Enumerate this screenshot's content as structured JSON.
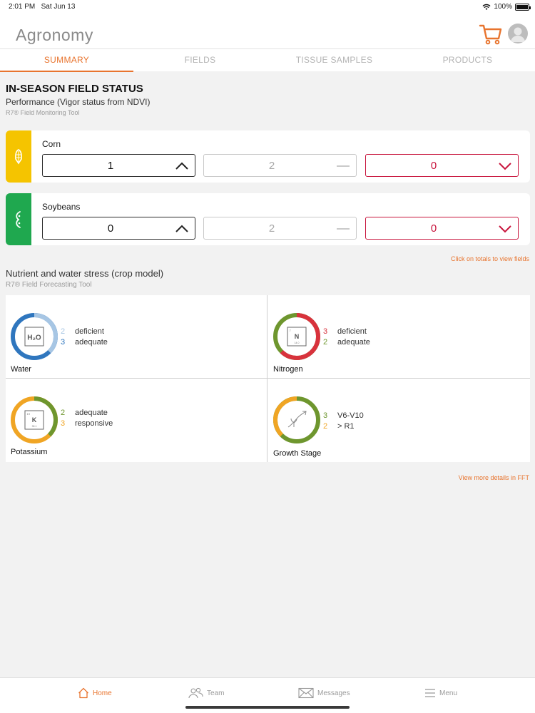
{
  "status_bar": {
    "time": "2:01 PM",
    "date": "Sat Jun 13",
    "battery": "100%"
  },
  "header": {
    "title": "Agronomy"
  },
  "tabs": [
    {
      "label": "SUMMARY",
      "active": true
    },
    {
      "label": "FIELDS",
      "active": false
    },
    {
      "label": "TISSUE SAMPLES",
      "active": false
    },
    {
      "label": "PRODUCTS",
      "active": false
    }
  ],
  "field_status": {
    "title": "IN-SEASON FIELD STATUS",
    "subtitle": "Performance (Vigor status from NDVI)",
    "tool": "R7® Field Monitoring Tool",
    "crops": [
      {
        "name": "Corn",
        "color": "#f5c400",
        "up": "1",
        "flat": "2",
        "down": "0"
      },
      {
        "name": "Soybeans",
        "color": "#1fa84f",
        "up": "0",
        "flat": "2",
        "down": "0"
      }
    ],
    "hint": "Click on totals to view fields"
  },
  "stress": {
    "title": "Nutrient and water stress (crop model)",
    "tool": "R7® Field Forecasting Tool",
    "cells": [
      {
        "name": "Water",
        "icon": "h2o-icon",
        "rows": [
          {
            "num": "2",
            "label": "deficient",
            "color": "#a7c6e4"
          },
          {
            "num": "3",
            "label": "adequate",
            "color": "#2f76be"
          }
        ]
      },
      {
        "name": "Nitrogen",
        "icon": "nitrogen-icon",
        "rows": [
          {
            "num": "3",
            "label": "deficient",
            "color": "#d8323c"
          },
          {
            "num": "2",
            "label": "adequate",
            "color": "#6e962e"
          }
        ]
      },
      {
        "name": "Potassium",
        "icon": "potassium-icon",
        "rows": [
          {
            "num": "2",
            "label": "adequate",
            "color": "#6e962e"
          },
          {
            "num": "3",
            "label": "responsive",
            "color": "#f0a524"
          }
        ]
      },
      {
        "name": "Growth Stage",
        "icon": "growth-stage-icon",
        "rows": [
          {
            "num": "3",
            "label": "V6-V10",
            "color": "#6e962e"
          },
          {
            "num": "2",
            "label": "> R1",
            "color": "#f0a524"
          }
        ]
      }
    ],
    "link": "View more details in FFT"
  },
  "bottom_nav": [
    {
      "label": "Home",
      "icon": "home-icon",
      "active": true
    },
    {
      "label": "Team",
      "icon": "team-icon",
      "active": false
    },
    {
      "label": "Messages",
      "icon": "messages-icon",
      "active": false
    },
    {
      "label": "Menu",
      "icon": "menu-icon",
      "active": false
    }
  ],
  "colors": {
    "accent": "#e8742e",
    "down": "#c8143c"
  }
}
